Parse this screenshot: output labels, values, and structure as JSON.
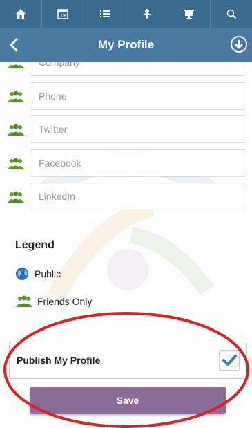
{
  "topbar": {
    "icons": [
      "home-icon",
      "calendar-icon",
      "list-icon",
      "tree-icon",
      "presentation-icon",
      "search-icon"
    ],
    "calendar_day": "19"
  },
  "header": {
    "title": "My Profile"
  },
  "fields": [
    {
      "placeholder": "Company"
    },
    {
      "placeholder": "Phone"
    },
    {
      "placeholder": "Twitter"
    },
    {
      "placeholder": "Facebook"
    },
    {
      "placeholder": "LinkedIn"
    }
  ],
  "legend": {
    "title": "Legend",
    "public_label": "Public",
    "friends_label": "Friends Only"
  },
  "publish": {
    "label": "Publish My Profile",
    "checked": true
  },
  "save": {
    "label": "Save"
  },
  "colors": {
    "topbar": "#3a6a8e",
    "header": "#4b7aa3",
    "friends_icon": "#5a9e2c",
    "public_icon": "#2c6db5",
    "check": "#3e7fb6",
    "save_button": "#8c6d97",
    "annotation": "#e02020"
  }
}
